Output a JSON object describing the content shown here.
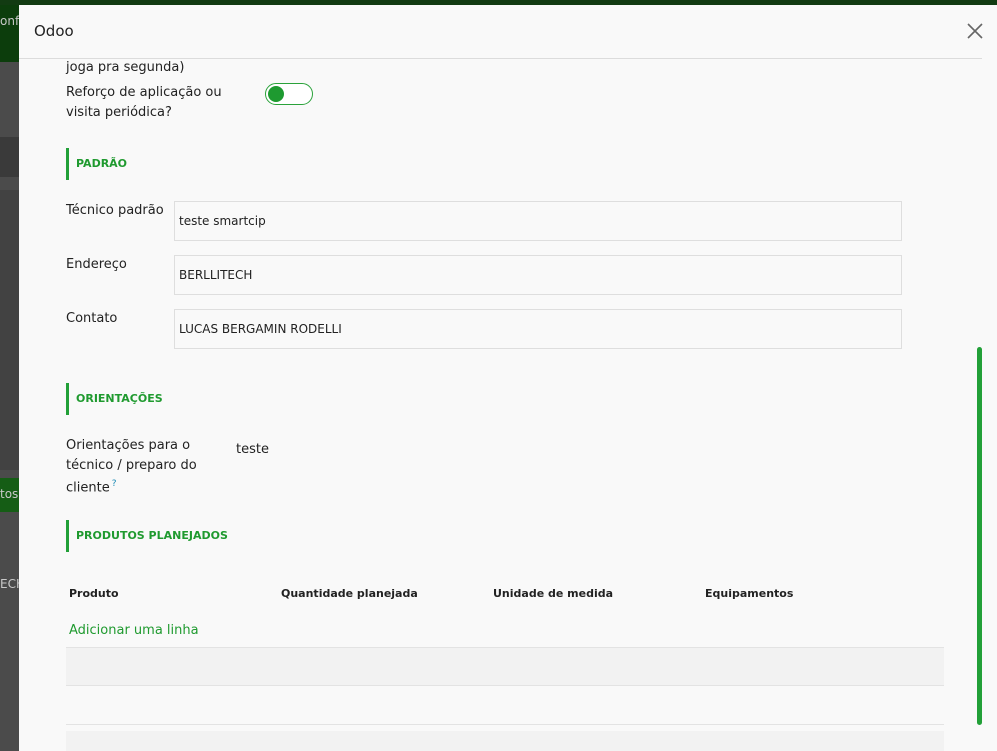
{
  "background": {
    "top_fragment": "onfi",
    "left_fragment_1": "tos",
    "left_fragment_2": "ECH"
  },
  "modal": {
    "title": "Odoo",
    "close_icon": "close-icon"
  },
  "form": {
    "partial_text": "joga pra segunda)",
    "reforco_label": "Reforço de aplicação ou visita periódica?",
    "reforco_value": true,
    "sections": {
      "padrao": "PADRÃO",
      "orientacoes": "ORIENTAÇÕES",
      "produtos": "PRODUTOS PLANEJADOS"
    },
    "tecnico_label": "Técnico padrão",
    "tecnico_value": "teste smartcip",
    "endereco_label": "Endereço",
    "endereco_value": "BERLLITECH",
    "contato_label": "Contato",
    "contato_value": "LUCAS BERGAMIN RODELLI",
    "orientacoes_label": "Orientações para o técnico / preparo do cliente",
    "orientacoes_help": "?",
    "orientacoes_value": "teste"
  },
  "table": {
    "headers": [
      "Produto",
      "Quantidade planejada",
      "Unidade de medida",
      "Equipamentos"
    ],
    "add_line": "Adicionar uma linha"
  },
  "colors": {
    "accent": "#22a038",
    "header_dark": "#0c3d0c"
  }
}
